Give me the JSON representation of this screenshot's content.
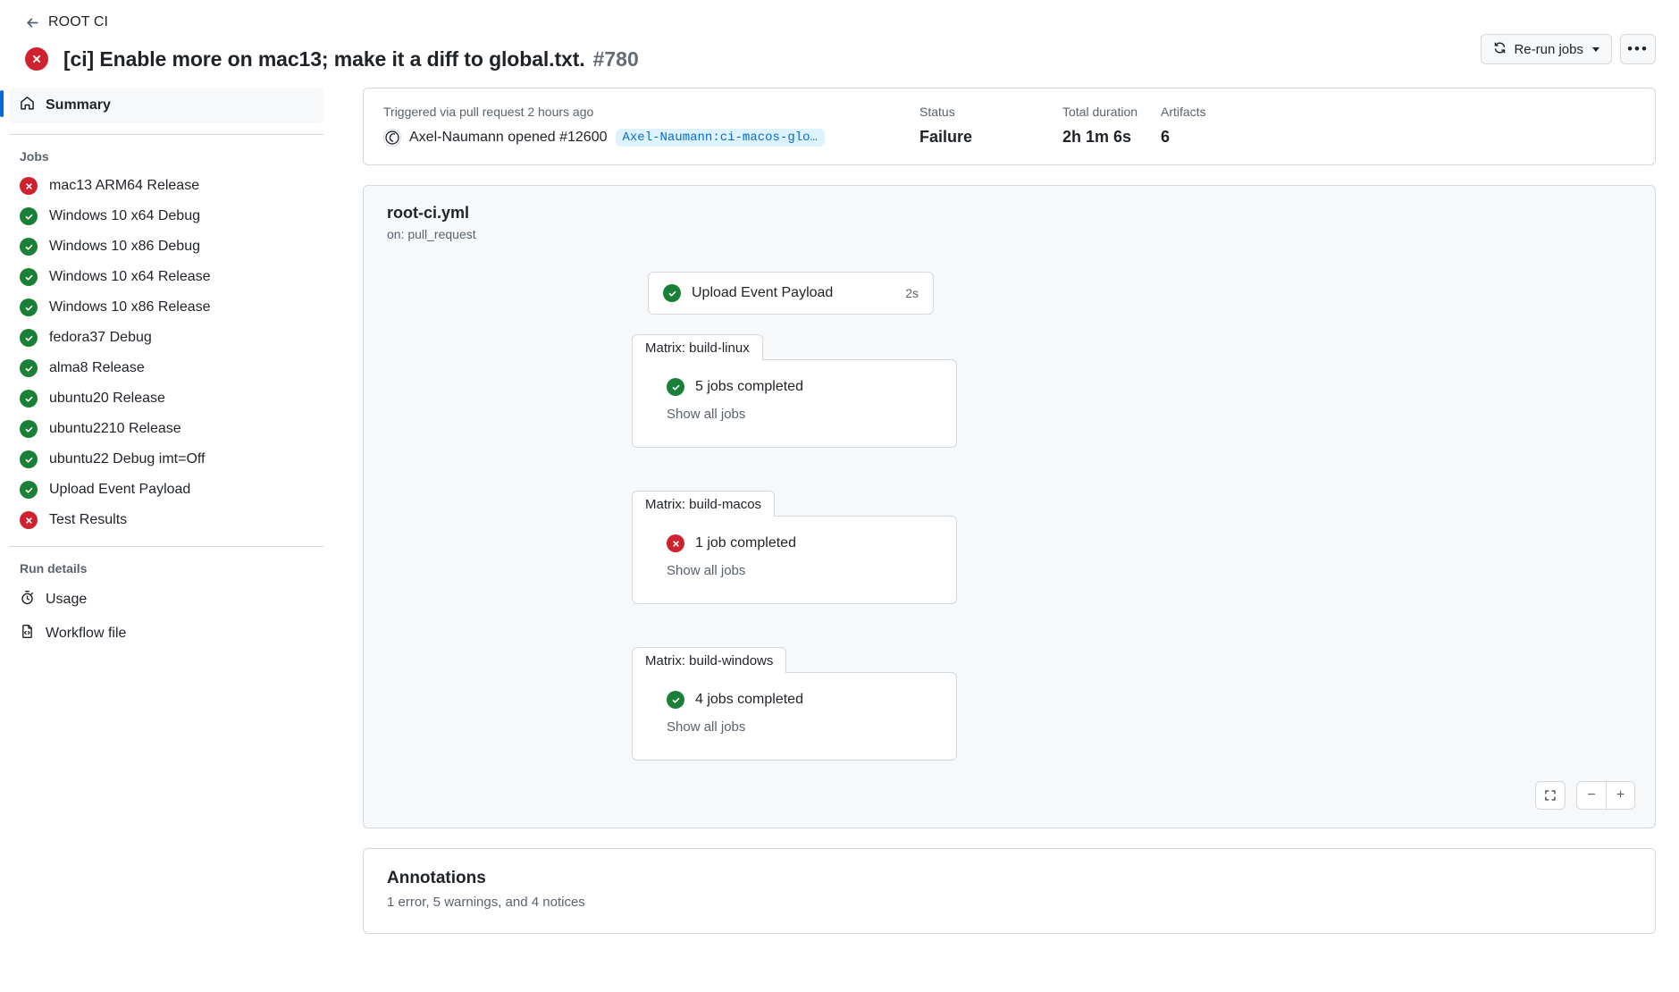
{
  "header": {
    "back_label": "ROOT CI",
    "back_icon": "arrow-left-icon",
    "run_status": "failure",
    "run_title": "[ci] Enable more on mac13; make it a diff to global.txt.",
    "run_number": "#780",
    "rerun_label": "Re-run jobs",
    "rerun_icon": "sync-icon",
    "overflow_label": "•••"
  },
  "sidebar": {
    "summary": {
      "label": "Summary",
      "icon": "home-icon"
    },
    "jobs_label": "Jobs",
    "jobs": [
      {
        "label": "mac13 ARM64 Release",
        "status": "failure"
      },
      {
        "label": "Windows 10 x64 Debug",
        "status": "success"
      },
      {
        "label": "Windows 10 x86 Debug",
        "status": "success"
      },
      {
        "label": "Windows 10 x64 Release",
        "status": "success"
      },
      {
        "label": "Windows 10 x86 Release",
        "status": "success"
      },
      {
        "label": "fedora37 Debug",
        "status": "success"
      },
      {
        "label": "alma8 Release",
        "status": "success"
      },
      {
        "label": "ubuntu20 Release",
        "status": "success"
      },
      {
        "label": "ubuntu2210 Release",
        "status": "success"
      },
      {
        "label": "ubuntu22 Debug imt=Off",
        "status": "success"
      },
      {
        "label": "Upload Event Payload",
        "status": "success"
      },
      {
        "label": "Test Results",
        "status": "failure"
      }
    ],
    "run_details_label": "Run details",
    "run_details": [
      {
        "label": "Usage",
        "icon": "stopwatch-icon"
      },
      {
        "label": "Workflow file",
        "icon": "file-code-icon"
      }
    ]
  },
  "meta": {
    "trigger_text": "Triggered via pull request 2 hours ago",
    "actor": "Axel-Naumann opened #12600",
    "avatar_icon": "user-avatar",
    "branch": "Axel-Naumann:ci-macos-glo…",
    "columns": [
      {
        "label": "Status",
        "value": "Failure"
      },
      {
        "label": "Total duration",
        "value": "2h 1m 6s"
      },
      {
        "label": "Artifacts",
        "value": "6"
      }
    ]
  },
  "graph": {
    "title": "root-ci.yml",
    "subtitle": "on: pull_request",
    "nodes": [
      {
        "label": "Upload Event Payload",
        "status": "success",
        "time": "2s"
      }
    ],
    "matrices": [
      {
        "tab": "Matrix: build-linux",
        "status": "success",
        "summary": "5 jobs completed",
        "link": "Show all jobs"
      },
      {
        "tab": "Matrix: build-macos",
        "status": "failure",
        "summary": "1 job completed",
        "link": "Show all jobs"
      },
      {
        "tab": "Matrix: build-windows",
        "status": "success",
        "summary": "4 jobs completed",
        "link": "Show all jobs"
      }
    ],
    "controls": {
      "fit_icon": "fit-screen-icon",
      "zoom_out": "−",
      "zoom_in": "+"
    }
  },
  "annotations": {
    "title": "Annotations",
    "subtitle": "1 error, 5 warnings, and 4 notices"
  },
  "colors": {
    "success": "#1a7f37",
    "failure": "#cf222e",
    "accent": "#0969da",
    "muted": "#59636e",
    "border": "#d1d9e0",
    "canvas_subtle": "#f6f8fa",
    "branch_bg": "#ddf4ff"
  }
}
